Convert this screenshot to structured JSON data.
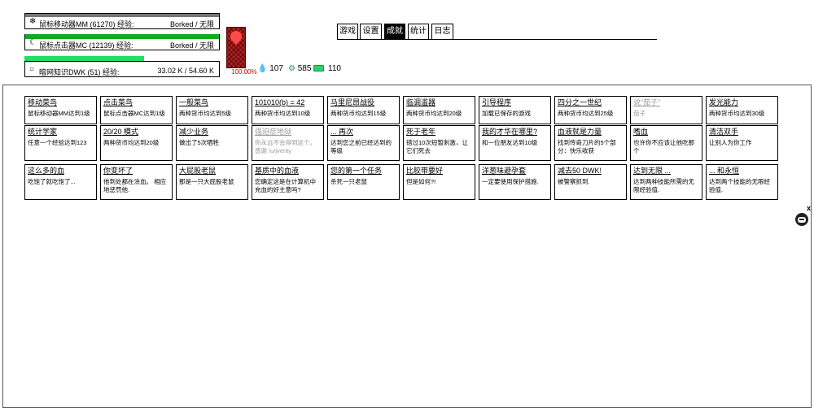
{
  "stats": [
    {
      "icon": "❄",
      "name": "鼠标移动器MM (61270) 经验:",
      "value": "Borked / 无限",
      "bar_color": "#777777",
      "bar_fill": 1.0
    },
    {
      "icon": "☾",
      "name": "鼠标点击器MC (12139) 经验:",
      "value": "Borked / 无限",
      "bar_color": "#11aa22",
      "bar_fill": 1.0
    },
    {
      "icon": "○",
      "name": "暗网知识DWK (51) 经验:",
      "value": "33.02 K / 54.60 K",
      "bar_color": "#22dd66",
      "bar_fill": 0.6
    }
  ],
  "card": {
    "percent": "100.00%"
  },
  "resources": {
    "blood": "107",
    "gears": "585",
    "battery": "110"
  },
  "tabs": [
    {
      "label": "游戏"
    },
    {
      "label": "设置"
    },
    {
      "label": "成就",
      "active": true
    },
    {
      "label": "统计"
    },
    {
      "label": "日志"
    }
  ],
  "achievements": [
    {
      "title": "移动菜鸟",
      "desc": "鼠标移动器MM达到1级"
    },
    {
      "title": "点击菜鸟",
      "desc": "鼠标点击器MC达到1级"
    },
    {
      "title": "一般菜鸟",
      "desc": "两种货币均达到5级"
    },
    {
      "title": "101010(b) = 42",
      "desc": "两种货币均达到10级"
    },
    {
      "title": "马里尼昂战役",
      "desc": "两种货币均达到15级"
    },
    {
      "title": "临调滥器",
      "desc": "两种货币均达到20级"
    },
    {
      "title": "引导程序",
      "desc": "加载已保存的游戏"
    },
    {
      "title": "四分之一世纪",
      "desc": "两种货币均达到25级"
    },
    {
      "title": "说“茄子”",
      "desc": "茄子",
      "dim": true
    },
    {
      "title": "发光能力",
      "desc": "两种货币均达到30级"
    },
    {
      "title": "统计学家",
      "desc": "任意一个经验达到123"
    },
    {
      "title": "20/20 模式",
      "desc": "两种货币均达到20级"
    },
    {
      "title": "减少业务",
      "desc": "做出了5次牺牲"
    },
    {
      "title": "强迫症地狱",
      "desc": "你永远不会得到这个。感谢 /u/jverity",
      "dim": true
    },
    {
      "title": "... 再次",
      "desc": "达到您之前已经达到的等级"
    },
    {
      "title": "死于老年",
      "desc": "错过10次短暂刺激，让它们死去"
    },
    {
      "title": "我的才华在哪里?",
      "desc": "和一位朋友达到10级"
    },
    {
      "title": "血液就是力量",
      "desc": "找到传奇刀片的5个部分：快乐收获"
    },
    {
      "title": "嗜血",
      "desc": "也许你不应该让他吃那个"
    },
    {
      "title": "清洁双手",
      "desc": "让别人为你工作"
    },
    {
      "title": "这么多的血",
      "desc": "吃饱了就吃饱了..."
    },
    {
      "title": "你变坏了",
      "desc": "他到处都在涂血。 相应地惩罚他."
    },
    {
      "title": "大屁股老鼠",
      "desc": "那是一只大屁股老鼠"
    },
    {
      "title": "基质中的血液",
      "desc": "您确定这是在计算机中充血的好主意吗?"
    },
    {
      "title": "您的第一个任务",
      "desc": "杀死一只老鼠"
    },
    {
      "title": "比胶带要好",
      "desc": "但是如何?!"
    },
    {
      "title": "洋葱味避孕套",
      "desc": "一定要使用保护措施."
    },
    {
      "title": "减去50 DWK!",
      "desc": "被警察抓到."
    },
    {
      "title": "达到无限 ...",
      "desc": "达到两种技能所需的无限经验值."
    },
    {
      "title": "... 和永恒",
      "desc": "达到两个技能的无限经验值."
    }
  ],
  "helper": {
    "close": "x"
  }
}
